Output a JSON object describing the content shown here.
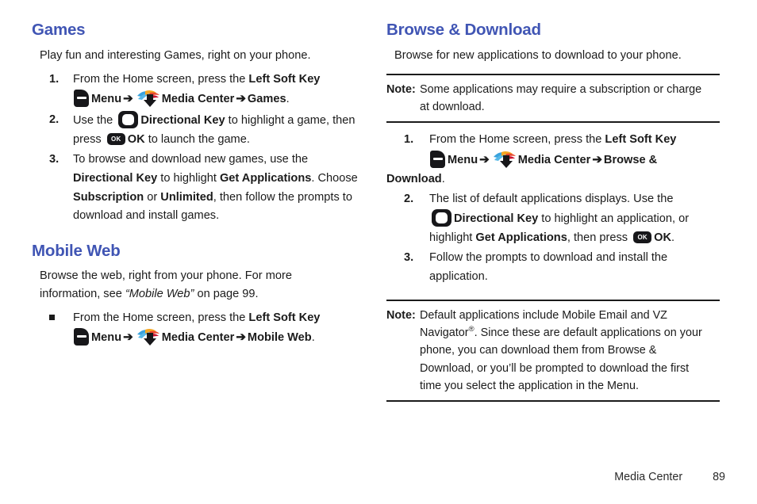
{
  "theme": {
    "heading_color": "#4055b4",
    "text_color": "#1b1b1b",
    "rule_color": "#1b1b1b",
    "page_background": "#ffffff"
  },
  "icons": {
    "soft_key": "left-soft-key-icon",
    "media_center": "media-center-icon",
    "directional_key": "directional-key-icon",
    "ok_key": "ok-key-icon",
    "arrow": "➔",
    "ok_key_label": "OK"
  },
  "left_column": {
    "games": {
      "heading": "Games",
      "intro": "Play fun and interesting Games, right on your phone.",
      "steps": [
        {
          "number": "1.",
          "parts": [
            {
              "type": "text",
              "value": "From the Home screen, press the "
            },
            {
              "type": "bold",
              "value": "Left Soft Key"
            },
            {
              "type": "icon",
              "value": "soft-key"
            },
            {
              "type": "bold",
              "value": "Menu"
            },
            {
              "type": "arrow"
            },
            {
              "type": "icon",
              "value": "media-center"
            },
            {
              "type": "bold",
              "value": "Media Center"
            },
            {
              "type": "arrow"
            },
            {
              "type": "bold",
              "value": "Games"
            },
            {
              "type": "text",
              "value": "."
            }
          ],
          "plain": "From the Home screen, press the Left Soft Key Menu ➔ Media Center ➔ Games."
        },
        {
          "number": "2.",
          "plain": "Use the Directional Key to highlight a game, then press OK to launch the game."
        },
        {
          "number": "3.",
          "plain": "To browse and download new games, use the Directional Key to highlight Get Applications. Choose Subscription or Unlimited, then follow the prompts to download and install games."
        }
      ]
    },
    "mobile_web": {
      "heading": "Mobile Web",
      "intro_1": "Browse the web, right from your phone. For more",
      "intro_2_prefix": "information, see ",
      "intro_2_italic": "“Mobile Web”",
      "intro_2_suffix": " on page 99.",
      "bullet": {
        "plain": "From the Home screen, press the Left Soft Key Menu ➔ Media Center ➔ Mobile Web."
      }
    }
  },
  "right_column": {
    "browse_download": {
      "heading": "Browse & Download",
      "intro": "Browse for new applications to download to your phone.",
      "note_top": {
        "label": "Note:",
        "text": "Some applications may require a subscription or charge at download."
      },
      "steps": [
        {
          "number": "1.",
          "plain": "From the Home screen, press the Left Soft Key Menu ➔ Media Center ➔ Browse & Download."
        },
        {
          "number": "2.",
          "plain": "The list of default applications displays. Use the Directional Key to highlight an application, or highlight Get Applications, then press OK."
        },
        {
          "number": "3.",
          "plain": "Follow the prompts to download and install the application."
        }
      ],
      "note_bottom": {
        "label": "Note:",
        "text": "Default applications include Mobile Email and VZ Navigator®. Since these are default applications on your phone, you can download them from Browse & Download, or you’ll be prompted to download the first time you select the application in the Menu."
      }
    }
  },
  "text": {
    "games_heading": "Games",
    "games_intro": "Play fun and interesting Games, right on your phone.",
    "mobile_web_heading": "Mobile Web",
    "browse_heading": "Browse & Download",
    "browse_intro": "Browse for new applications to download to your phone.",
    "num_1": "1.",
    "num_2": "2.",
    "num_3": "3.",
    "note_label": "Note:",
    "from_home_screen": "From the Home screen, press the ",
    "left_soft_key": "Left Soft Key",
    "menu": "Menu",
    "media_center": "Media Center",
    "games_link": "Games",
    "period": ".",
    "use_the": "Use the ",
    "directional_key": "Directional Key",
    "to_highlight_game": " to highlight a game, then",
    "press": "press ",
    "ok": "OK",
    "to_launch": " to launch the game.",
    "step3_line1": "To browse and download new games, use the",
    "step3_directional": "Directional Key",
    "step3_to_highlight": " to highlight ",
    "step3_get_apps": "Get Applications",
    "step3_choose": ". Choose",
    "step3_subscription": "Subscription",
    "step3_or": " or ",
    "step3_unlimited": "Unlimited",
    "step3_then_follow": ", then follow the prompts to",
    "step3_last": "download and install games.",
    "mw_line1": "Browse the web, right from your phone. For more",
    "mw_line2_prefix": "information, see ",
    "mw_line2_italic": "“Mobile Web”",
    "mw_line2_suffix": " on page 99.",
    "mobile_web_link": "Mobile Web",
    "note_top_text_1": "Some applications may require a subscription or charge",
    "note_top_text_2": "at download.",
    "browse_and": "Browse &",
    "download_word": "Download",
    "r_step2_line1": "The list of default applications displays. Use the",
    "r_step2_mid": " to highlight an application, or",
    "r_step2_highlight": "highlight ",
    "r_step2_getapps": "Get Applications",
    "r_step2_thenpress": ", then press ",
    "r_step3_line1": "Follow the prompts to download and install the",
    "r_step3_line2": "application.",
    "note_bottom_1": "Default applications include Mobile Email and VZ",
    "note_bottom_2a": "Navigator",
    "note_bottom_reg": "®",
    "note_bottom_2b": ". Since these are default applications on your",
    "note_bottom_3": "phone, you can download them from Browse &",
    "note_bottom_4": "Download, or you’ll be prompted to download the first",
    "note_bottom_5": "time you select the application in the Menu."
  },
  "footer": {
    "chapter": "Media Center",
    "page_number": "89"
  }
}
